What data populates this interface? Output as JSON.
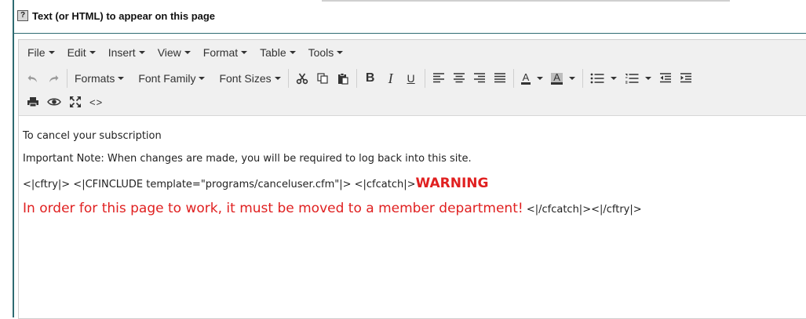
{
  "section": {
    "help_symbol": "?",
    "title": "Text (or HTML) to appear on this page"
  },
  "menubar": [
    {
      "label": "File"
    },
    {
      "label": "Edit"
    },
    {
      "label": "Insert"
    },
    {
      "label": "View"
    },
    {
      "label": "Format"
    },
    {
      "label": "Table"
    },
    {
      "label": "Tools"
    }
  ],
  "toolbar": {
    "formats_label": "Formats",
    "font_family_label": "Font Family",
    "font_sizes_label": "Font Sizes",
    "bold_glyph": "B",
    "italic_glyph": "I",
    "underline_glyph": "U",
    "text_color_glyph": "A",
    "bg_color_glyph": "A",
    "code_glyph": "<>"
  },
  "content": {
    "line1": "To cancel your subscription",
    "line2": "Important Note: When changes are made, you will be required to log back into this site.",
    "line3_code": "<|cftry|> <|CFINCLUDE template=\"programs/canceluser.cfm\"|> <|cfcatch|>",
    "line3_warning": "WARNING",
    "line4_message": "In order for this page to work, it must be moved to a member department!",
    "line4_code": " <|/cfcatch|><|/cftry|>"
  },
  "colors": {
    "accent": "#2e6b72",
    "warning_red": "#e02020",
    "toolbar_bg": "#f0f0f0"
  }
}
